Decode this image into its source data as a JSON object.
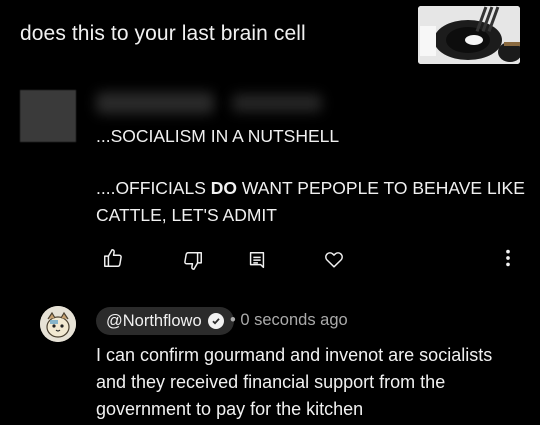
{
  "header": {
    "title": "does this to your last brain cell"
  },
  "comment": {
    "lines": [
      "...SOCIALISM IN A NUTSHELL"
    ],
    "second_line_1_pre": "....OFFICIALS ",
    "second_line_1_bold": "DO",
    "second_line_1_post": " WANT PEPOPLE TO BEHAVE LIKE",
    "second_line_2": "CATTLE, LET'S ADMIT",
    "actions": [
      "like-icon",
      "dislike-icon",
      "reply-icon",
      "heart-icon",
      "more-icon"
    ]
  },
  "reply": {
    "handle": "@Northflowo",
    "meta": "• 0 seconds ago",
    "text_lines": [
      "I can confirm gourmand and invenot are socialists",
      "and they received financial support from the",
      "government to pay for the kitchen"
    ]
  },
  "colors": {
    "background": "#000000",
    "text": "#f1f1f1",
    "secondary": "#aaaaaa",
    "pill": "#2b2b2b"
  }
}
